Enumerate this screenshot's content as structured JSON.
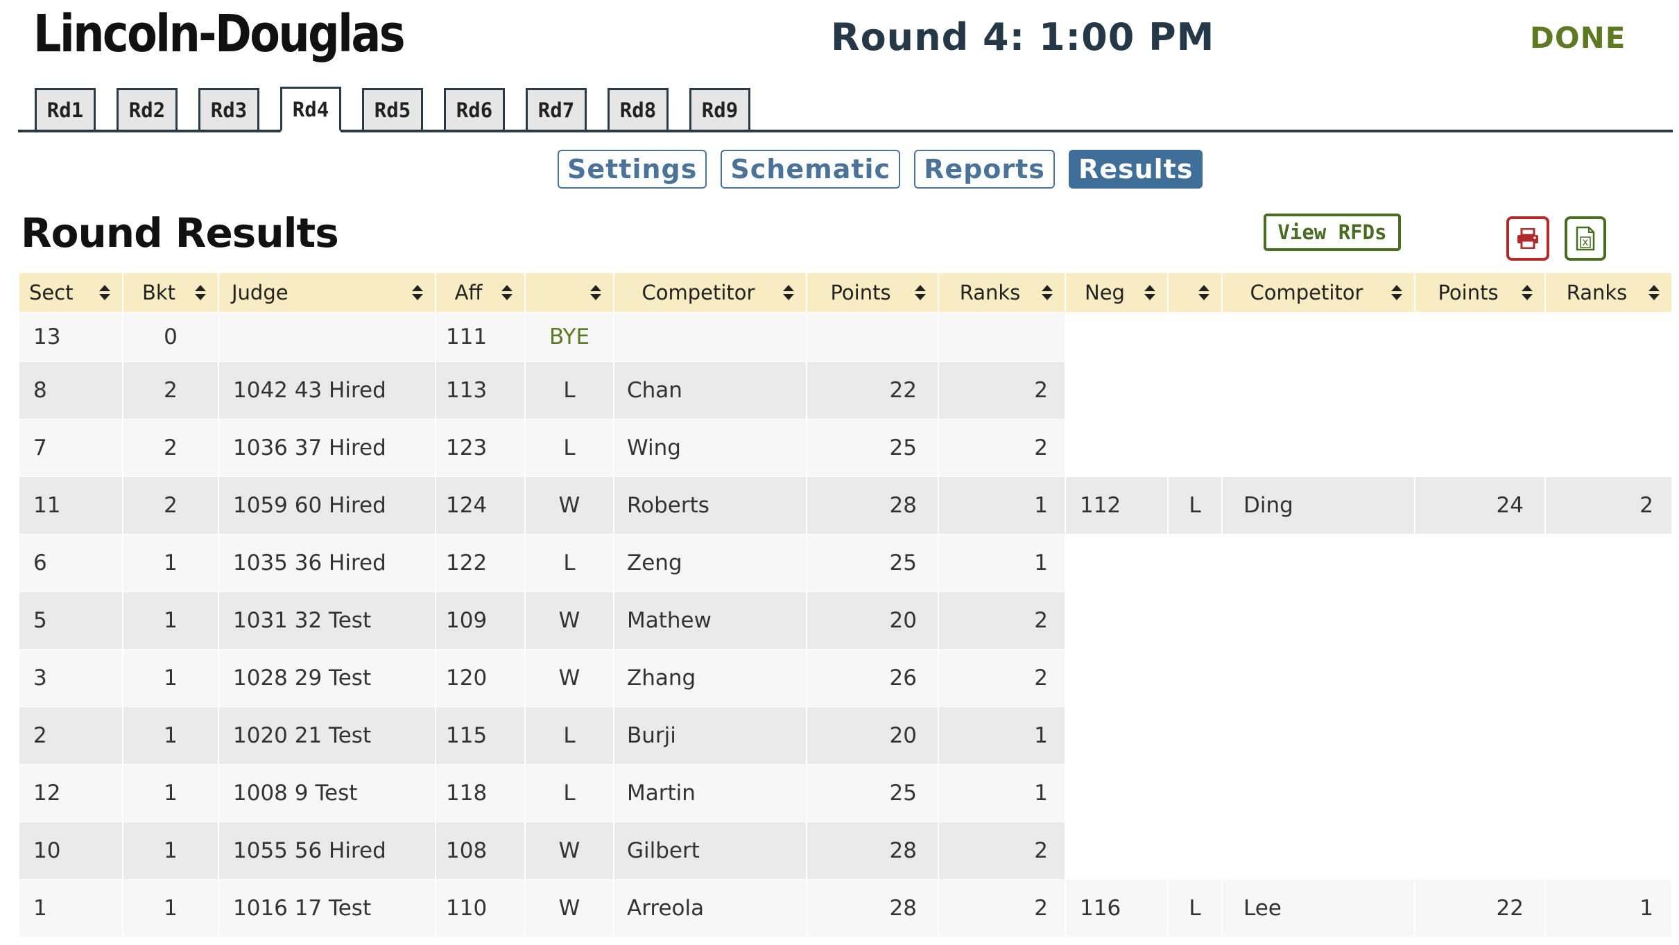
{
  "header": {
    "title": "Lincoln-Douglas",
    "round_time": "Round 4: 1:00 PM",
    "done_label": "DONE"
  },
  "round_tabs": [
    {
      "label": "Rd1",
      "active": false
    },
    {
      "label": "Rd2",
      "active": false
    },
    {
      "label": "Rd3",
      "active": false
    },
    {
      "label": "Rd4",
      "active": true
    },
    {
      "label": "Rd5",
      "active": false
    },
    {
      "label": "Rd6",
      "active": false
    },
    {
      "label": "Rd7",
      "active": false
    },
    {
      "label": "Rd8",
      "active": false
    },
    {
      "label": "Rd9",
      "active": false
    }
  ],
  "subnav": {
    "settings": "Settings",
    "schematic": "Schematic",
    "reports": "Reports",
    "results": "Results",
    "active": "Results"
  },
  "section": {
    "title": "Round Results",
    "view_rfds_label": "View RFDs",
    "print_icon": "printer-icon",
    "excel_icon": "excel-file-icon"
  },
  "table": {
    "headers": [
      "Sect",
      "Bkt",
      "Judge",
      "Aff",
      "",
      "Competitor",
      "Points",
      "Ranks",
      "Neg",
      "",
      "Competitor",
      "Points",
      "Ranks"
    ],
    "rows": [
      {
        "sect": "13",
        "bkt": "0",
        "judge": "",
        "aff": "111",
        "aff_result": "BYE",
        "aff_competitor": "",
        "aff_points": "",
        "aff_ranks": "",
        "neg": null,
        "neg_result": "",
        "neg_competitor": "",
        "neg_points": "",
        "neg_ranks": ""
      },
      {
        "sect": "8",
        "bkt": "2",
        "judge": "1042 43 Hired",
        "aff": "113",
        "aff_result": "L",
        "aff_competitor": "Chan",
        "aff_points": "22",
        "aff_ranks": "2",
        "neg": null,
        "neg_result": "",
        "neg_competitor": "",
        "neg_points": "",
        "neg_ranks": ""
      },
      {
        "sect": "7",
        "bkt": "2",
        "judge": "1036 37 Hired",
        "aff": "123",
        "aff_result": "L",
        "aff_competitor": "Wing",
        "aff_points": "25",
        "aff_ranks": "2",
        "neg": null,
        "neg_result": "",
        "neg_competitor": "",
        "neg_points": "",
        "neg_ranks": ""
      },
      {
        "sect": "11",
        "bkt": "2",
        "judge": "1059 60 Hired",
        "aff": "124",
        "aff_result": "W",
        "aff_competitor": "Roberts",
        "aff_points": "28",
        "aff_ranks": "1",
        "neg": "112",
        "neg_result": "L",
        "neg_competitor": "Ding",
        "neg_points": "24",
        "neg_ranks": "2"
      },
      {
        "sect": "6",
        "bkt": "1",
        "judge": "1035 36 Hired",
        "aff": "122",
        "aff_result": "L",
        "aff_competitor": "Zeng",
        "aff_points": "25",
        "aff_ranks": "1",
        "neg": null,
        "neg_result": "",
        "neg_competitor": "",
        "neg_points": "",
        "neg_ranks": ""
      },
      {
        "sect": "5",
        "bkt": "1",
        "judge": "1031 32 Test",
        "aff": "109",
        "aff_result": "W",
        "aff_competitor": "Mathew",
        "aff_points": "20",
        "aff_ranks": "2",
        "neg": null,
        "neg_result": "",
        "neg_competitor": "",
        "neg_points": "",
        "neg_ranks": ""
      },
      {
        "sect": "3",
        "bkt": "1",
        "judge": "1028 29 Test",
        "aff": "120",
        "aff_result": "W",
        "aff_competitor": "Zhang",
        "aff_points": "26",
        "aff_ranks": "2",
        "neg": null,
        "neg_result": "",
        "neg_competitor": "",
        "neg_points": "",
        "neg_ranks": ""
      },
      {
        "sect": "2",
        "bkt": "1",
        "judge": "1020 21 Test",
        "aff": "115",
        "aff_result": "L",
        "aff_competitor": "Burji",
        "aff_points": "20",
        "aff_ranks": "1",
        "neg": null,
        "neg_result": "",
        "neg_competitor": "",
        "neg_points": "",
        "neg_ranks": ""
      },
      {
        "sect": "12",
        "bkt": "1",
        "judge": "1008 9 Test",
        "aff": "118",
        "aff_result": "L",
        "aff_competitor": "Martin",
        "aff_points": "25",
        "aff_ranks": "1",
        "neg": null,
        "neg_result": "",
        "neg_competitor": "",
        "neg_points": "",
        "neg_ranks": ""
      },
      {
        "sect": "10",
        "bkt": "1",
        "judge": "1055 56 Hired",
        "aff": "108",
        "aff_result": "W",
        "aff_competitor": "Gilbert",
        "aff_points": "28",
        "aff_ranks": "2",
        "neg": null,
        "neg_result": "",
        "neg_competitor": "",
        "neg_points": "",
        "neg_ranks": ""
      },
      {
        "sect": "1",
        "bkt": "1",
        "judge": "1016 17 Test",
        "aff": "110",
        "aff_result": "W",
        "aff_competitor": "Arreola",
        "aff_points": "28",
        "aff_ranks": "2",
        "neg": "116",
        "neg_result": "L",
        "neg_competitor": "Lee",
        "neg_points": "22",
        "neg_ranks": "1"
      }
    ]
  },
  "colors": {
    "header_bg": "#f8ecc2",
    "nav_blue": "#4b7397",
    "done_green": "#5d7a23",
    "print_red": "#b02a2a"
  }
}
